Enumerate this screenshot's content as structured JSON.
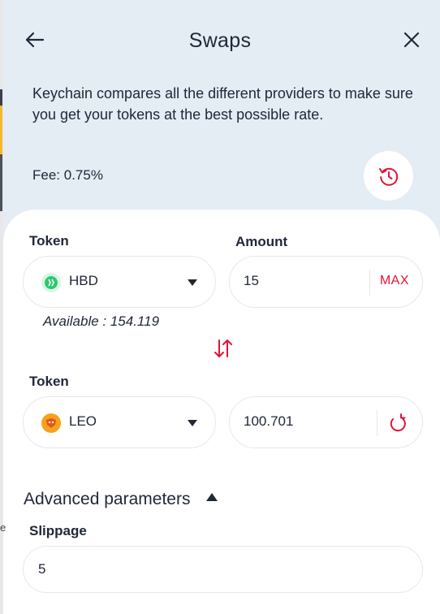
{
  "header": {
    "title": "Swaps",
    "intro": "Keychain compares all the different providers to make sure you get your tokens at the best possible rate.",
    "fee": "Fee: 0.75%"
  },
  "from": {
    "token_label": "Token",
    "amount_label": "Amount",
    "token": "HBD",
    "amount": "15",
    "max_label": "MAX",
    "available": "Available : 154.119"
  },
  "to": {
    "token_label": "Token",
    "token": "LEO",
    "amount": "100.701"
  },
  "advanced": {
    "label": "Advanced parameters",
    "slippage_label": "Slippage",
    "slippage_value": "5"
  },
  "icons": {
    "back": "arrow-left-icon",
    "close": "close-icon",
    "history": "history-icon",
    "swap": "swap-arrows-icon",
    "refresh": "refresh-icon"
  },
  "colors": {
    "accent": "#e31337",
    "header_bg": "#e4ecf4",
    "hbd": "#2cc86e",
    "leo": "#f7a21b"
  },
  "side_mark": "e"
}
